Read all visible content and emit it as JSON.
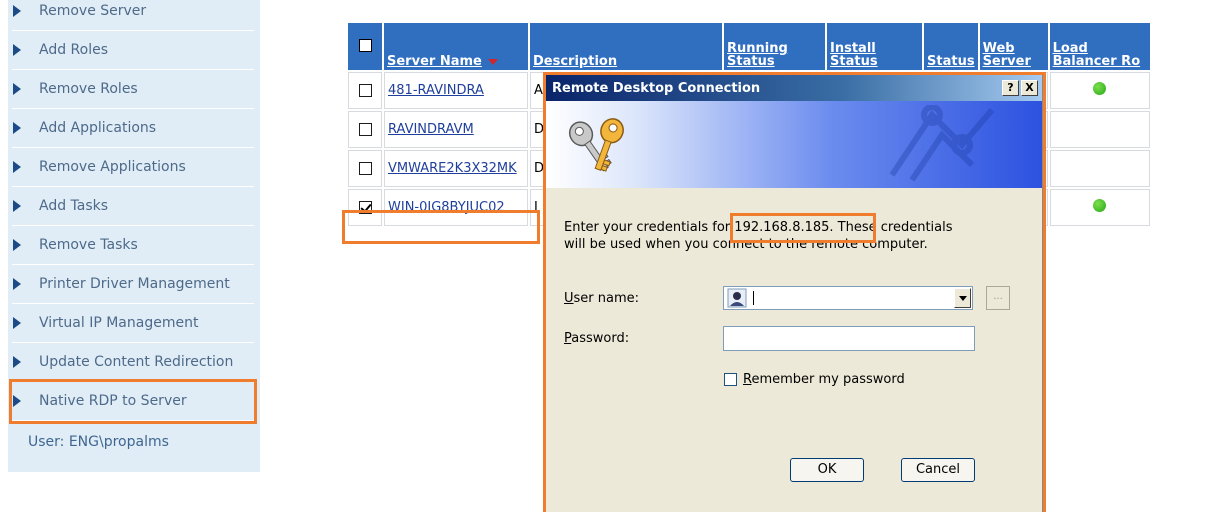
{
  "sidebar": {
    "items": [
      {
        "label": "Remove Server"
      },
      {
        "label": "Add Roles"
      },
      {
        "label": "Remove Roles"
      },
      {
        "label": "Add Applications"
      },
      {
        "label": "Remove Applications"
      },
      {
        "label": "Add Tasks"
      },
      {
        "label": "Remove Tasks"
      },
      {
        "label": "Printer Driver Management"
      },
      {
        "label": "Virtual IP Management"
      },
      {
        "label": "Update Content Redirection"
      },
      {
        "label": "Native RDP to Server"
      }
    ],
    "user_text": "User: ENG\\propalms"
  },
  "table": {
    "headers": {
      "server_name": "Server Name",
      "description": "Description",
      "running_status": "Running Status",
      "install_status": "Install Status",
      "status": "Status",
      "web_server": "Web Server",
      "load_balancer": "Load Balancer Ro"
    },
    "rows": [
      {
        "server_name": "481-RAVINDRA",
        "description": "A j",
        "checked": false
      },
      {
        "server_name": "RAVINDRAVM",
        "description": "D",
        "checked": false
      },
      {
        "server_name": "VMWARE2K3X32MK",
        "description": "D",
        "checked": false
      },
      {
        "server_name": "WIN-0IG8BYJUC02",
        "description": "I",
        "checked": true
      }
    ]
  },
  "dialog": {
    "title": "Remote Desktop Connection",
    "help_btn": "?",
    "close_btn": "X",
    "message_line1_pre": "Enter your credentials for ",
    "message_ip": "192.168.8.185",
    "message_line1_post": ". These credentials",
    "message_line2": "will be used when you connect to the remote computer.",
    "user_name_label_u": "U",
    "user_name_label_rest": "ser name:",
    "password_label_u": "P",
    "password_label_rest": "assword:",
    "user_name_value": "",
    "browse_label": "...",
    "remember_u": "R",
    "remember_rest": "emember my password",
    "ok_label": "OK",
    "cancel_label": "Cancel"
  },
  "colors": {
    "accent": "#f07d2e",
    "header_blue": "#306ec0",
    "sidebar_bg": "#e1edf6",
    "status_green": "#28a51a"
  }
}
